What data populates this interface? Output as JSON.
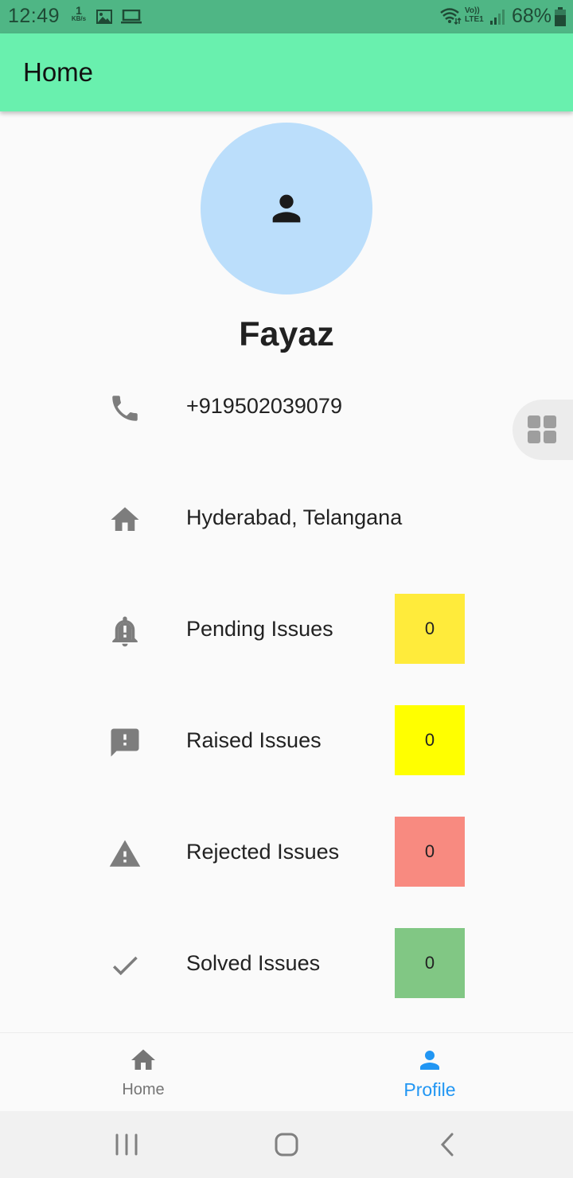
{
  "status_bar": {
    "time": "12:49",
    "net_speed_value": "1",
    "net_speed_unit": "KB/s",
    "network_label_top": "Vo))",
    "network_label_bottom": "LTE1",
    "battery": "68%"
  },
  "app_bar": {
    "title": "Home"
  },
  "profile": {
    "name": "Fayaz",
    "phone": "+919502039079",
    "location": "Hyderabad, Telangana"
  },
  "issues": [
    {
      "label": "Pending Issues",
      "count": "0",
      "color": "#ffeb3b",
      "icon": "notification-important-icon"
    },
    {
      "label": "Raised Issues",
      "count": "0",
      "color": "#ffff00",
      "icon": "feedback-icon"
    },
    {
      "label": "Rejected Issues",
      "count": "0",
      "color": "#f88a80",
      "icon": "warning-icon"
    },
    {
      "label": "Solved Issues",
      "count": "0",
      "color": "#81c784",
      "icon": "check-icon"
    }
  ],
  "bottom_nav": {
    "items": [
      {
        "label": "Home",
        "icon": "home-icon",
        "active": false
      },
      {
        "label": "Profile",
        "icon": "person-icon",
        "active": true
      }
    ],
    "active_color": "#2196f3",
    "inactive_color": "#757575"
  },
  "colors": {
    "status_bar": "#4fb685",
    "app_bar": "#69f0ae",
    "avatar_bg": "#bbdefb"
  }
}
